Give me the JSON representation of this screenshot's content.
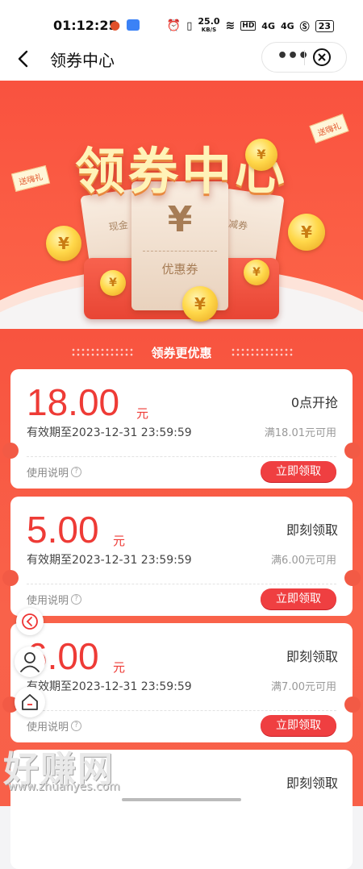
{
  "status_bar": {
    "time": "01:12:25",
    "net_speed_value": "25.0",
    "net_speed_unit": "KB/S",
    "hd_badge": "HD",
    "signal_1": "4G",
    "signal_2": "4G",
    "battery": "23"
  },
  "nav": {
    "title": "领券中心",
    "more_label": "•••"
  },
  "hero": {
    "title": "领券中心",
    "voucher_center_text": "优惠券",
    "voucher_symbol": "¥",
    "left_card_text": "现金",
    "right_card_text": "减券",
    "tag_left": "送嗨礼",
    "tag_right": "送嗨礼",
    "coin_symbol": "¥"
  },
  "section": {
    "title": "领券更优惠"
  },
  "coupons": [
    {
      "amount": "18.00",
      "unit": "元",
      "status": "0点开抢",
      "validity": "有效期至2023-12-31 23:59:59",
      "condition": "满18.01元可用",
      "help_label": "使用说明",
      "button_label": "立即领取"
    },
    {
      "amount": "5.00",
      "unit": "元",
      "status": "即刻领取",
      "validity": "有效期至2023-12-31 23:59:59",
      "condition": "满6.00元可用",
      "help_label": "使用说明",
      "button_label": "立即领取"
    },
    {
      "amount": "6.00",
      "unit": "元",
      "status": "即刻领取",
      "validity": "有效期至2023-12-31 23:59:59",
      "condition": "满7.00元可用",
      "help_label": "使用说明",
      "button_label": "立即领取"
    },
    {
      "amount": "",
      "unit": "",
      "status": "即刻领取",
      "validity": "",
      "condition": "",
      "help_label": "",
      "button_label": ""
    }
  ],
  "watermark": {
    "text": "好赚网",
    "sub": "www.zhuanyes.com"
  },
  "colors": {
    "accent_red": "#ef3f41",
    "amount_red": "#ee3b36",
    "hero_bg": "#f9523f"
  }
}
